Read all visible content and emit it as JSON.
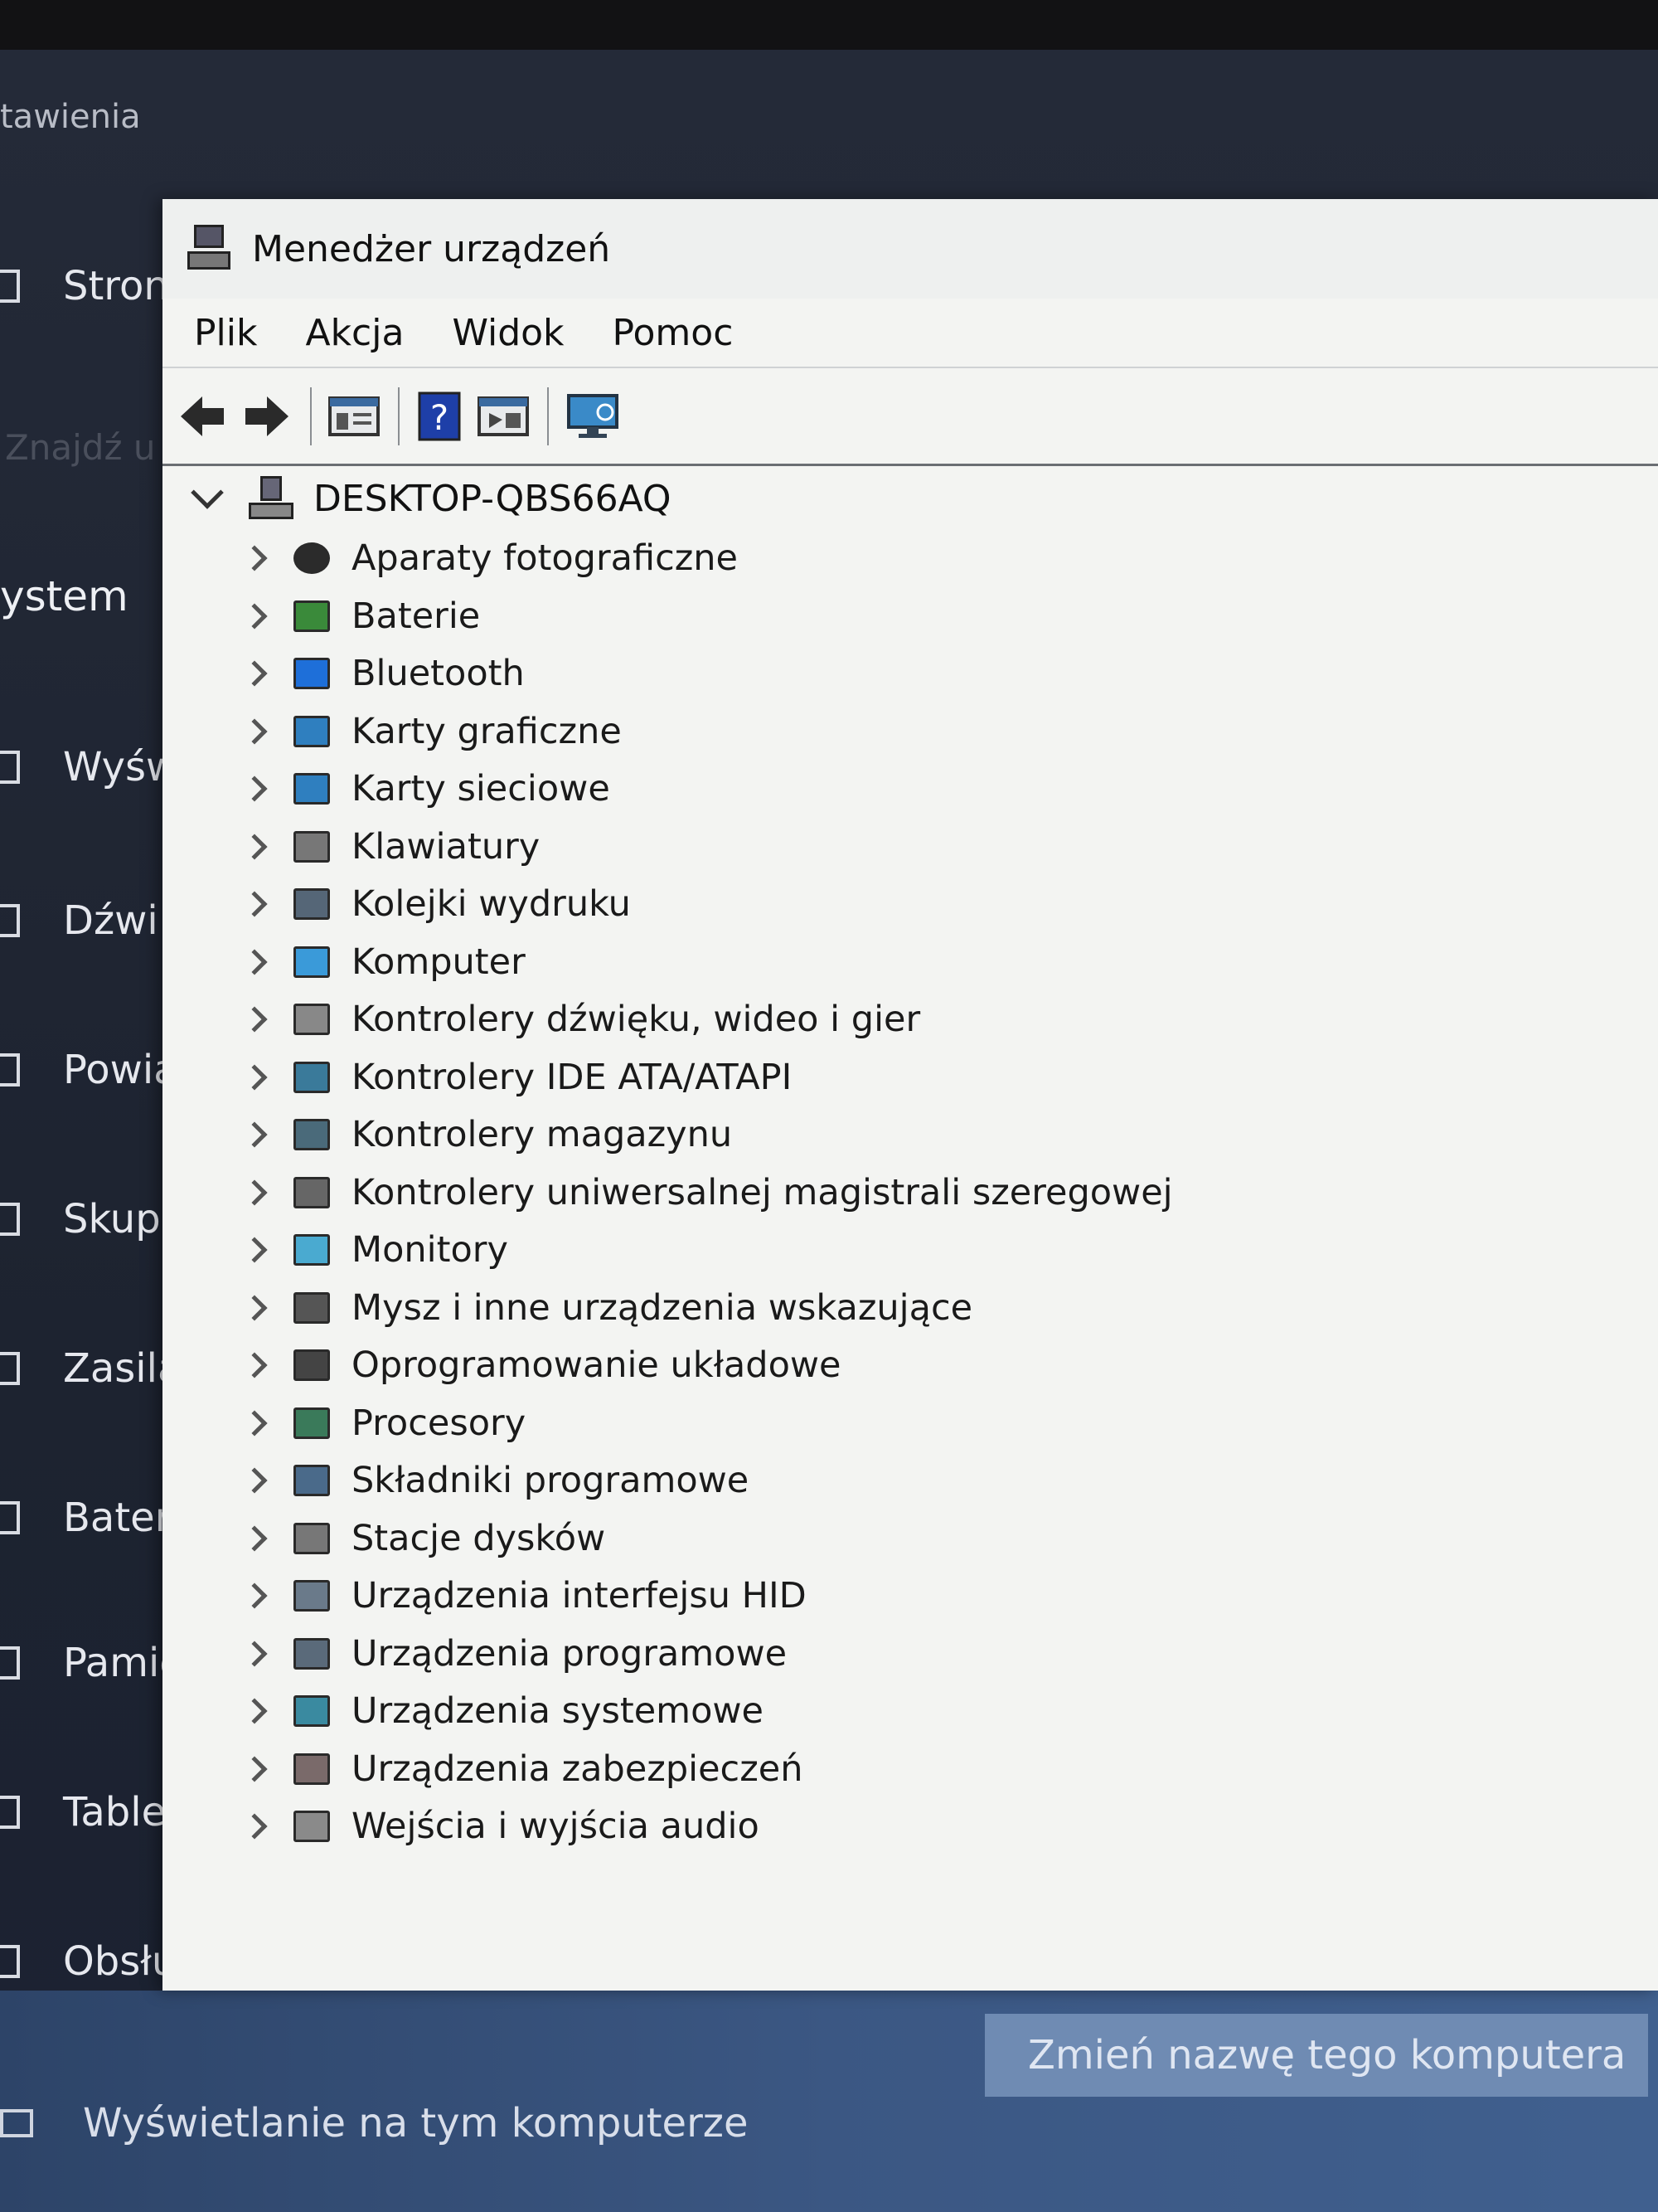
{
  "settings": {
    "title": "tawienia",
    "faint_text": "Znajdź u",
    "section_heading": "ystem",
    "nav_items": [
      {
        "label": "Stron",
        "icon": "home-icon"
      },
      {
        "label": "Wyśw",
        "icon": "display-icon"
      },
      {
        "label": "Dźwi",
        "icon": "sound-icon"
      },
      {
        "label": "Powia",
        "icon": "notifications-icon"
      },
      {
        "label": "Skup",
        "icon": "focus-icon"
      },
      {
        "label": "Zasila",
        "icon": "power-icon"
      },
      {
        "label": "Bater",
        "icon": "battery-icon"
      },
      {
        "label": "Pamię",
        "icon": "storage-icon"
      },
      {
        "label": "Table",
        "icon": "tablet-icon"
      },
      {
        "label": "Obsłu",
        "icon": "multitasking-icon"
      }
    ],
    "display_link": "Wyświetlanie na tym komputerze",
    "rename_button": "Zmień nazwę tego komputera"
  },
  "device_manager": {
    "title": "Menedżer urządzeń",
    "menu": [
      "Plik",
      "Akcja",
      "Widok",
      "Pomoc"
    ],
    "toolbar": [
      "back-icon",
      "forward-icon",
      "properties-icon",
      "help-icon",
      "update-driver-icon",
      "scan-hardware-icon"
    ],
    "root": "DESKTOP-QBS66AQ",
    "categories": [
      {
        "label": "Aparaty fotograficzne",
        "icon": "camera-icon",
        "color": "#2b2b2b"
      },
      {
        "label": "Baterie",
        "icon": "battery-icon",
        "color": "#3a8a3a"
      },
      {
        "label": "Bluetooth",
        "icon": "bluetooth-icon",
        "color": "#1e6fd9"
      },
      {
        "label": "Karty graficzne",
        "icon": "display-adapter-icon",
        "color": "#2f7fbf"
      },
      {
        "label": "Karty sieciowe",
        "icon": "network-adapter-icon",
        "color": "#2f7fbf"
      },
      {
        "label": "Klawiatury",
        "icon": "keyboard-icon",
        "color": "#777777"
      },
      {
        "label": "Kolejki wydruku",
        "icon": "printer-icon",
        "color": "#556677"
      },
      {
        "label": "Komputer",
        "icon": "computer-icon",
        "color": "#3a9ad9"
      },
      {
        "label": "Kontrolery dźwięku, wideo i gier",
        "icon": "speaker-icon",
        "color": "#888888"
      },
      {
        "label": "Kontrolery IDE ATA/ATAPI",
        "icon": "ide-controller-icon",
        "color": "#3a7a9a"
      },
      {
        "label": "Kontrolery magazynu",
        "icon": "storage-controller-icon",
        "color": "#4a6a7a"
      },
      {
        "label": "Kontrolery uniwersalnej magistrali szeregowej",
        "icon": "usb-icon",
        "color": "#666666"
      },
      {
        "label": "Monitory",
        "icon": "monitor-icon",
        "color": "#4aaad0"
      },
      {
        "label": "Mysz i inne urządzenia wskazujące",
        "icon": "mouse-icon",
        "color": "#555555"
      },
      {
        "label": "Oprogramowanie układowe",
        "icon": "firmware-icon",
        "color": "#444444"
      },
      {
        "label": "Procesory",
        "icon": "processor-icon",
        "color": "#3a7a5a"
      },
      {
        "label": "Składniki programowe",
        "icon": "software-component-icon",
        "color": "#4a6a8a"
      },
      {
        "label": "Stacje dysków",
        "icon": "disk-drive-icon",
        "color": "#777777"
      },
      {
        "label": "Urządzenia interfejsu HID",
        "icon": "hid-icon",
        "color": "#6a7a8a"
      },
      {
        "label": "Urządzenia programowe",
        "icon": "software-device-icon",
        "color": "#5a6a7a"
      },
      {
        "label": "Urządzenia systemowe",
        "icon": "system-device-icon",
        "color": "#3a8aa0"
      },
      {
        "label": "Urządzenia zabezpieczeń",
        "icon": "security-device-icon",
        "color": "#7a6a6a"
      },
      {
        "label": "Wejścia i wyjścia audio",
        "icon": "audio-io-icon",
        "color": "#8a8a8a"
      }
    ]
  }
}
